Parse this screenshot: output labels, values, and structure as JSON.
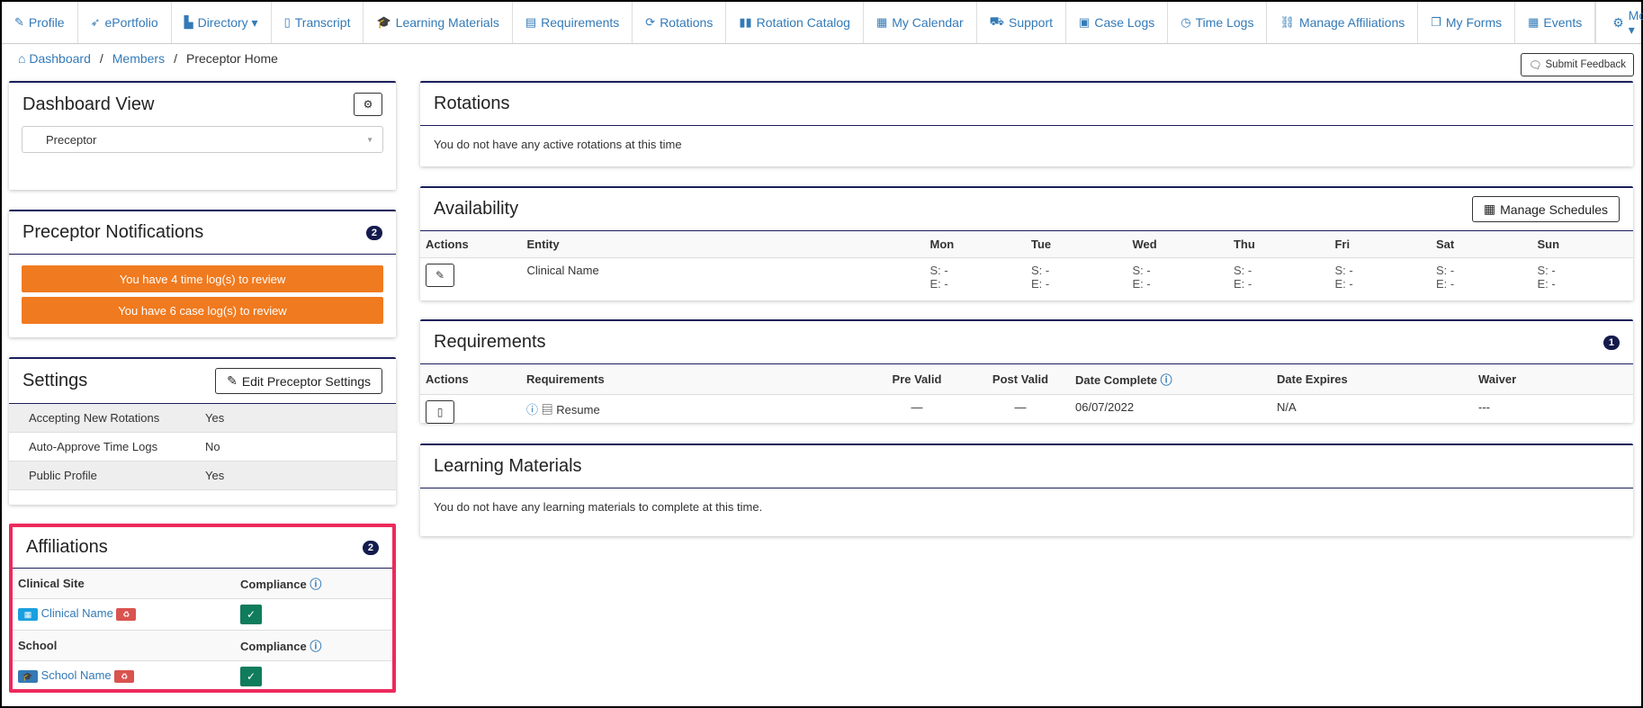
{
  "nav": {
    "items": [
      {
        "label": "Profile",
        "icon": "pencil-icon",
        "glyph": "✎"
      },
      {
        "label": "ePortfolio",
        "icon": "rocket-icon",
        "glyph": "➶"
      },
      {
        "label": "Directory ▾",
        "icon": "sitemap-icon",
        "glyph": "▙"
      },
      {
        "label": "Transcript",
        "icon": "file-icon",
        "glyph": "▯"
      },
      {
        "label": "Learning Materials",
        "icon": "graduation-cap-icon",
        "glyph": "🎓"
      },
      {
        "label": "Requirements",
        "icon": "book-icon",
        "glyph": "▤"
      },
      {
        "label": "Rotations",
        "icon": "refresh-icon",
        "glyph": "⟳"
      },
      {
        "label": "Rotation Catalog",
        "icon": "book-open-icon",
        "glyph": "▮▮"
      },
      {
        "label": "My Calendar",
        "icon": "calendar-icon",
        "glyph": "▦"
      },
      {
        "label": "Support",
        "icon": "truck-icon",
        "glyph": "⛟"
      },
      {
        "label": "Case Logs",
        "icon": "briefcase-icon",
        "glyph": "▣"
      },
      {
        "label": "Time Logs",
        "icon": "clock-icon",
        "glyph": "◷"
      },
      {
        "label": "Manage Affiliations",
        "icon": "link-icon",
        "glyph": "⛓"
      },
      {
        "label": "My Forms",
        "icon": "window-icon",
        "glyph": "❐"
      },
      {
        "label": "Events",
        "icon": "calendar-icon",
        "glyph": "▦"
      }
    ],
    "more": "More ▾"
  },
  "breadcrumb": {
    "dashboard": "Dashboard",
    "members": "Members",
    "current": "Preceptor Home"
  },
  "feedback": "Submit Feedback",
  "dashboard_view": {
    "title": "Dashboard View",
    "selected": "Preceptor"
  },
  "notifications": {
    "title": "Preceptor Notifications",
    "count": "2",
    "items": [
      "You have 4 time log(s) to review",
      "You have 6 case log(s) to review"
    ]
  },
  "settings": {
    "title": "Settings",
    "edit": "Edit Preceptor Settings",
    "rows": [
      [
        "Accepting New Rotations",
        "Yes"
      ],
      [
        "Auto-Approve Time Logs",
        "No"
      ],
      [
        "Public Profile",
        "Yes"
      ]
    ]
  },
  "affiliations": {
    "title": "Affiliations",
    "count": "2",
    "site_header": "Clinical Site",
    "compliance": "Compliance",
    "site": "Clinical Name",
    "school_header": "School",
    "school": "School Name"
  },
  "rotations": {
    "title": "Rotations",
    "empty": "You do not have any active rotations at this time"
  },
  "availability": {
    "title": "Availability",
    "manage": "Manage Schedules",
    "headers": [
      "Actions",
      "Entity",
      "Mon",
      "Tue",
      "Wed",
      "Thu",
      "Fri",
      "Sat",
      "Sun"
    ],
    "entity": "Clinical Name",
    "start": "S: -",
    "end": "E: -"
  },
  "requirements": {
    "title": "Requirements",
    "count": "1",
    "headers": [
      "Actions",
      "Requirements",
      "Pre Valid",
      "Post Valid",
      "Date Complete",
      "Date Expires",
      "Waiver"
    ],
    "row": {
      "name": "Resume",
      "pre": "—",
      "post": "—",
      "complete": "06/07/2022",
      "expires": "N/A",
      "waiver": "---"
    }
  },
  "learning": {
    "title": "Learning Materials",
    "empty": "You do not have any learning materials to complete at this time."
  }
}
